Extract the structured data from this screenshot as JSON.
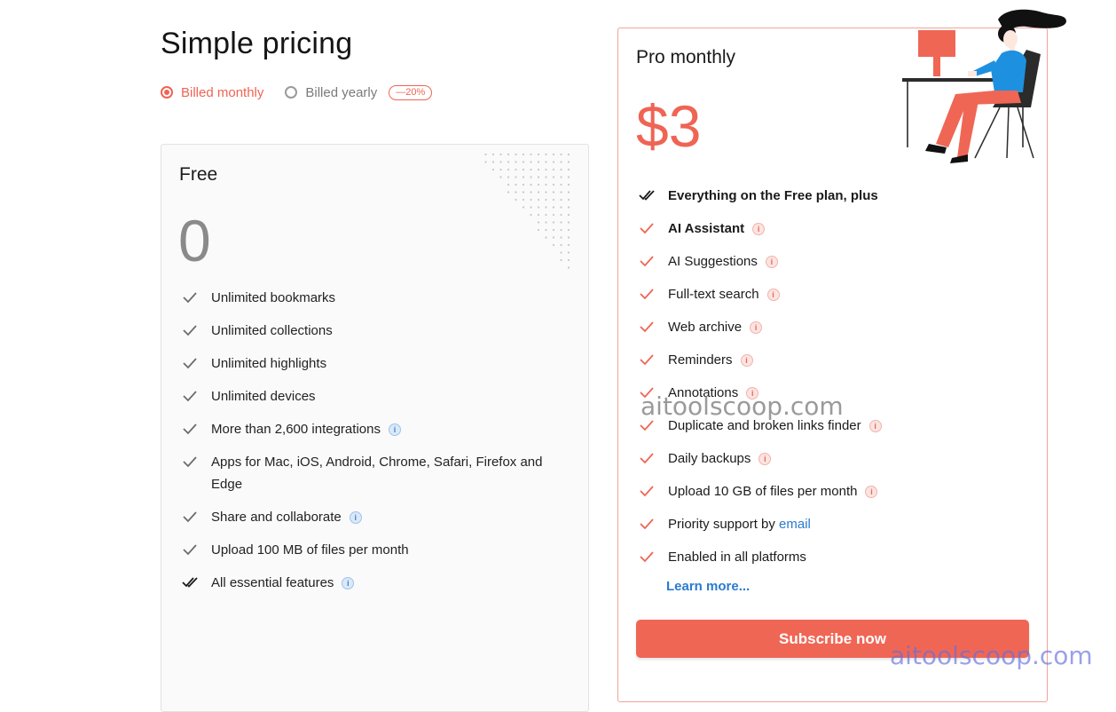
{
  "header": {
    "title": "Simple pricing",
    "billing": {
      "monthly_label": "Billed monthly",
      "yearly_label": "Billed yearly",
      "discount_badge": "—20%",
      "selected": "monthly"
    }
  },
  "free_plan": {
    "name": "Free",
    "price": "0",
    "features": [
      {
        "text": "Unlimited bookmarks",
        "info": false,
        "icon": "check-icon"
      },
      {
        "text": "Unlimited collections",
        "info": false,
        "icon": "check-icon"
      },
      {
        "text": "Unlimited highlights",
        "info": false,
        "icon": "check-icon"
      },
      {
        "text": "Unlimited devices",
        "info": false,
        "icon": "check-icon"
      },
      {
        "text": "More than 2,600 integrations",
        "info": true,
        "icon": "check-icon"
      },
      {
        "text": "Apps for Mac, iOS, Android, Chrome, Safari, Firefox and Edge",
        "info": false,
        "icon": "check-icon"
      },
      {
        "text": "Share and collaborate",
        "info": true,
        "icon": "check-icon"
      },
      {
        "text": "Upload 100 MB of files per month",
        "info": false,
        "icon": "check-icon"
      },
      {
        "text": "All essential features",
        "info": true,
        "icon": "double-check-icon"
      }
    ]
  },
  "pro_plan": {
    "name": "Pro monthly",
    "price": "$3",
    "features": [
      {
        "text": "Everything on the Free plan, plus",
        "bold": true,
        "info": false,
        "icon": "double-check-icon"
      },
      {
        "text": "AI Assistant",
        "bold": true,
        "info": true,
        "icon": "check-icon"
      },
      {
        "text": "AI Suggestions",
        "info": true,
        "icon": "check-icon"
      },
      {
        "text": "Full-text search",
        "info": true,
        "icon": "check-icon"
      },
      {
        "text": "Web archive",
        "info": true,
        "icon": "check-icon"
      },
      {
        "text": "Reminders",
        "info": true,
        "icon": "check-icon"
      },
      {
        "text": "Annotations",
        "info": true,
        "icon": "check-icon"
      },
      {
        "text": "Duplicate and broken links finder",
        "info": true,
        "icon": "check-icon"
      },
      {
        "text": "Daily backups",
        "info": true,
        "icon": "check-icon"
      },
      {
        "text": "Upload 10 GB of files per month",
        "info": true,
        "icon": "check-icon"
      },
      {
        "text": "Priority support by ",
        "link": "email",
        "info": false,
        "icon": "check-icon"
      },
      {
        "text": "Enabled in all platforms",
        "info": false,
        "icon": "check-icon"
      }
    ],
    "learn_more": "Learn more...",
    "subscribe_label": "Subscribe now"
  },
  "watermark": "aitoolscoop.com",
  "colors": {
    "accent": "#ef6454",
    "link": "#2a7bd0",
    "check_free": "#6b6b6b",
    "illustration_shirt": "#1e90e0"
  }
}
